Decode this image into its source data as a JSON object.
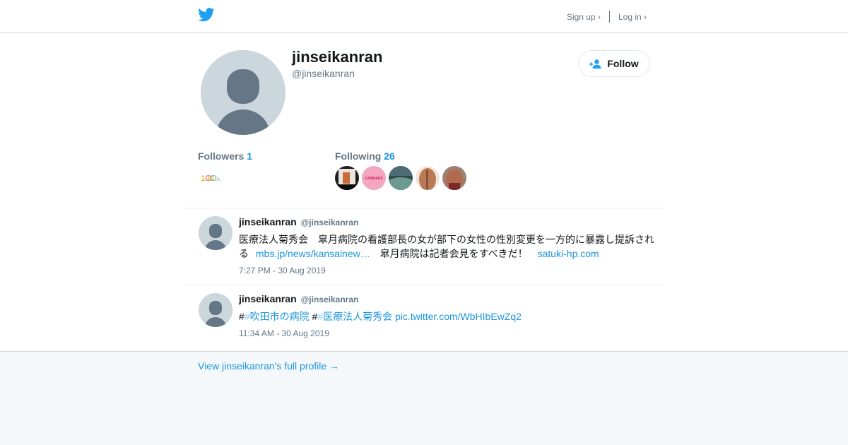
{
  "header": {
    "signup_label": "Sign up ›",
    "login_label": "Log in ›",
    "brand_color": "#1da1f2"
  },
  "profile": {
    "name": "jinseikanran",
    "handle": "@jinseikanran",
    "follow_label": "Follow"
  },
  "stats": {
    "followers_label": "Followers",
    "followers_count": "1",
    "following_label": "Following",
    "following_count": "26"
  },
  "followers_thumbs": [
    {
      "name": "follower-thumb-100",
      "text": "100"
    }
  ],
  "following_thumbs": [
    {
      "name": "following-thumb-1"
    },
    {
      "name": "following-thumb-canmake",
      "text": "CANMAKE"
    },
    {
      "name": "following-thumb-3"
    },
    {
      "name": "following-thumb-4"
    },
    {
      "name": "following-thumb-5"
    }
  ],
  "tweets": [
    {
      "name": "jinseikanran",
      "handle": "@jinseikanran",
      "text_part1": "医療法人菊秀会　皐月病院の看護部長の女が部下の女性の性別変更を一方的に暴露し提訴される",
      "link1": "mbs.jp/news/kansainew…",
      "text_part2": "皐月病院は記者会見をすべきだ！",
      "link2": "satuki-hp.com",
      "time": "7:27 PM - 30 Aug 2019"
    },
    {
      "name": "jinseikanran",
      "handle": "@jinseikanran",
      "hash_prefix1": "#",
      "hashtag1": "吹田市の病院",
      "hash_prefix2": "#",
      "hashtag2": "医療法人菊秀会",
      "link": "pic.twitter.com/WbHIbEwZq2",
      "time": "11:34 AM - 30 Aug 2019"
    }
  ],
  "footer": {
    "full_profile_link": "View jinseikanran's full profile →"
  }
}
